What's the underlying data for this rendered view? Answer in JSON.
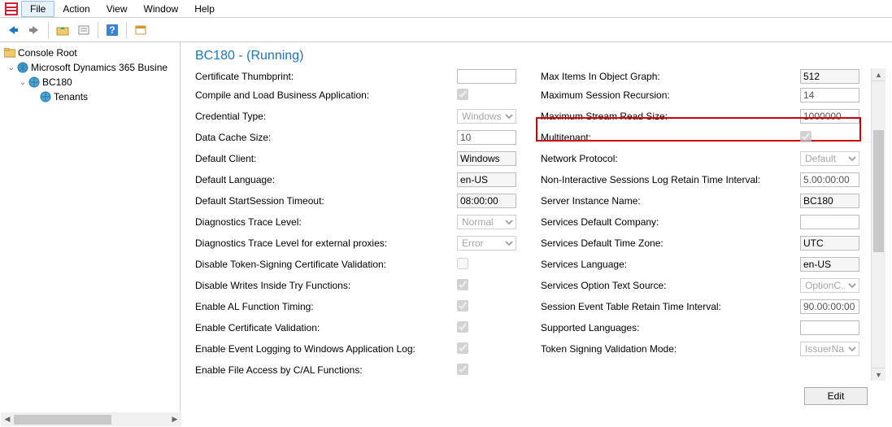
{
  "menu": {
    "file": "File",
    "action": "Action",
    "view": "View",
    "window": "Window",
    "help": "Help"
  },
  "tree": {
    "root": "Console Root",
    "node1": "Microsoft Dynamics 365 Busine",
    "node2": "BC180",
    "node3": "Tenants"
  },
  "detail": {
    "title": "BC180 - (Running)",
    "left": {
      "cert_thumbprint": {
        "label": "Certificate Thumbprint:",
        "value": ""
      },
      "compile_load": {
        "label": "Compile and Load Business Application:",
        "checked": true
      },
      "credential_type": {
        "label": "Credential Type:",
        "value": "Windows"
      },
      "data_cache": {
        "label": "Data Cache Size:",
        "value": "10"
      },
      "default_client": {
        "label": "Default Client:",
        "value": "Windows"
      },
      "default_lang": {
        "label": "Default Language:",
        "value": "en-US"
      },
      "default_start_timeout": {
        "label": "Default StartSession Timeout:",
        "value": "08:00:00"
      },
      "diag_trace": {
        "label": "Diagnostics Trace Level:",
        "value": "Normal"
      },
      "diag_trace_ext": {
        "label": "Diagnostics Trace Level for external proxies:",
        "value": "Error"
      },
      "disable_token_sign": {
        "label": "Disable Token-Signing Certificate Validation:",
        "checked": false
      },
      "disable_writes": {
        "label": "Disable Writes Inside Try Functions:",
        "checked": true
      },
      "enable_al_timing": {
        "label": "Enable AL Function Timing:",
        "checked": true
      },
      "enable_cert_valid": {
        "label": "Enable Certificate Validation:",
        "checked": true
      },
      "enable_event_log": {
        "label": "Enable Event Logging to Windows Application Log:",
        "checked": true
      },
      "enable_file_access": {
        "label": "Enable File Access by C/AL Functions:",
        "checked": true
      }
    },
    "right": {
      "max_items": {
        "label": "Max Items In Object Graph:",
        "value": "512"
      },
      "max_recursion": {
        "label": "Maximum Session Recursion:",
        "value": "14"
      },
      "max_stream": {
        "label": "Maximum Stream Read Size:",
        "value": "1000000"
      },
      "multitenant": {
        "label": "Multitenant:",
        "checked": true
      },
      "network_protocol": {
        "label": "Network Protocol:",
        "value": "Default"
      },
      "noninteractive": {
        "label": "Non-Interactive Sessions Log Retain Time Interval:",
        "value": "5.00:00:00"
      },
      "server_instance": {
        "label": "Server Instance Name:",
        "value": "BC180"
      },
      "svc_company": {
        "label": "Services Default Company:",
        "value": ""
      },
      "svc_tz": {
        "label": "Services Default Time Zone:",
        "value": "UTC"
      },
      "svc_lang": {
        "label": "Services Language:",
        "value": "en-US"
      },
      "svc_option_text": {
        "label": "Services Option Text Source:",
        "value": "OptionC..."
      },
      "session_event_retain": {
        "label": "Session Event Table Retain Time Interval:",
        "value": "90.00:00:00"
      },
      "supported_lang": {
        "label": "Supported Languages:",
        "value": ""
      },
      "token_sign_mode": {
        "label": "Token Signing Validation Mode:",
        "value": "IssuerNa..."
      }
    },
    "edit_btn": "Edit"
  }
}
